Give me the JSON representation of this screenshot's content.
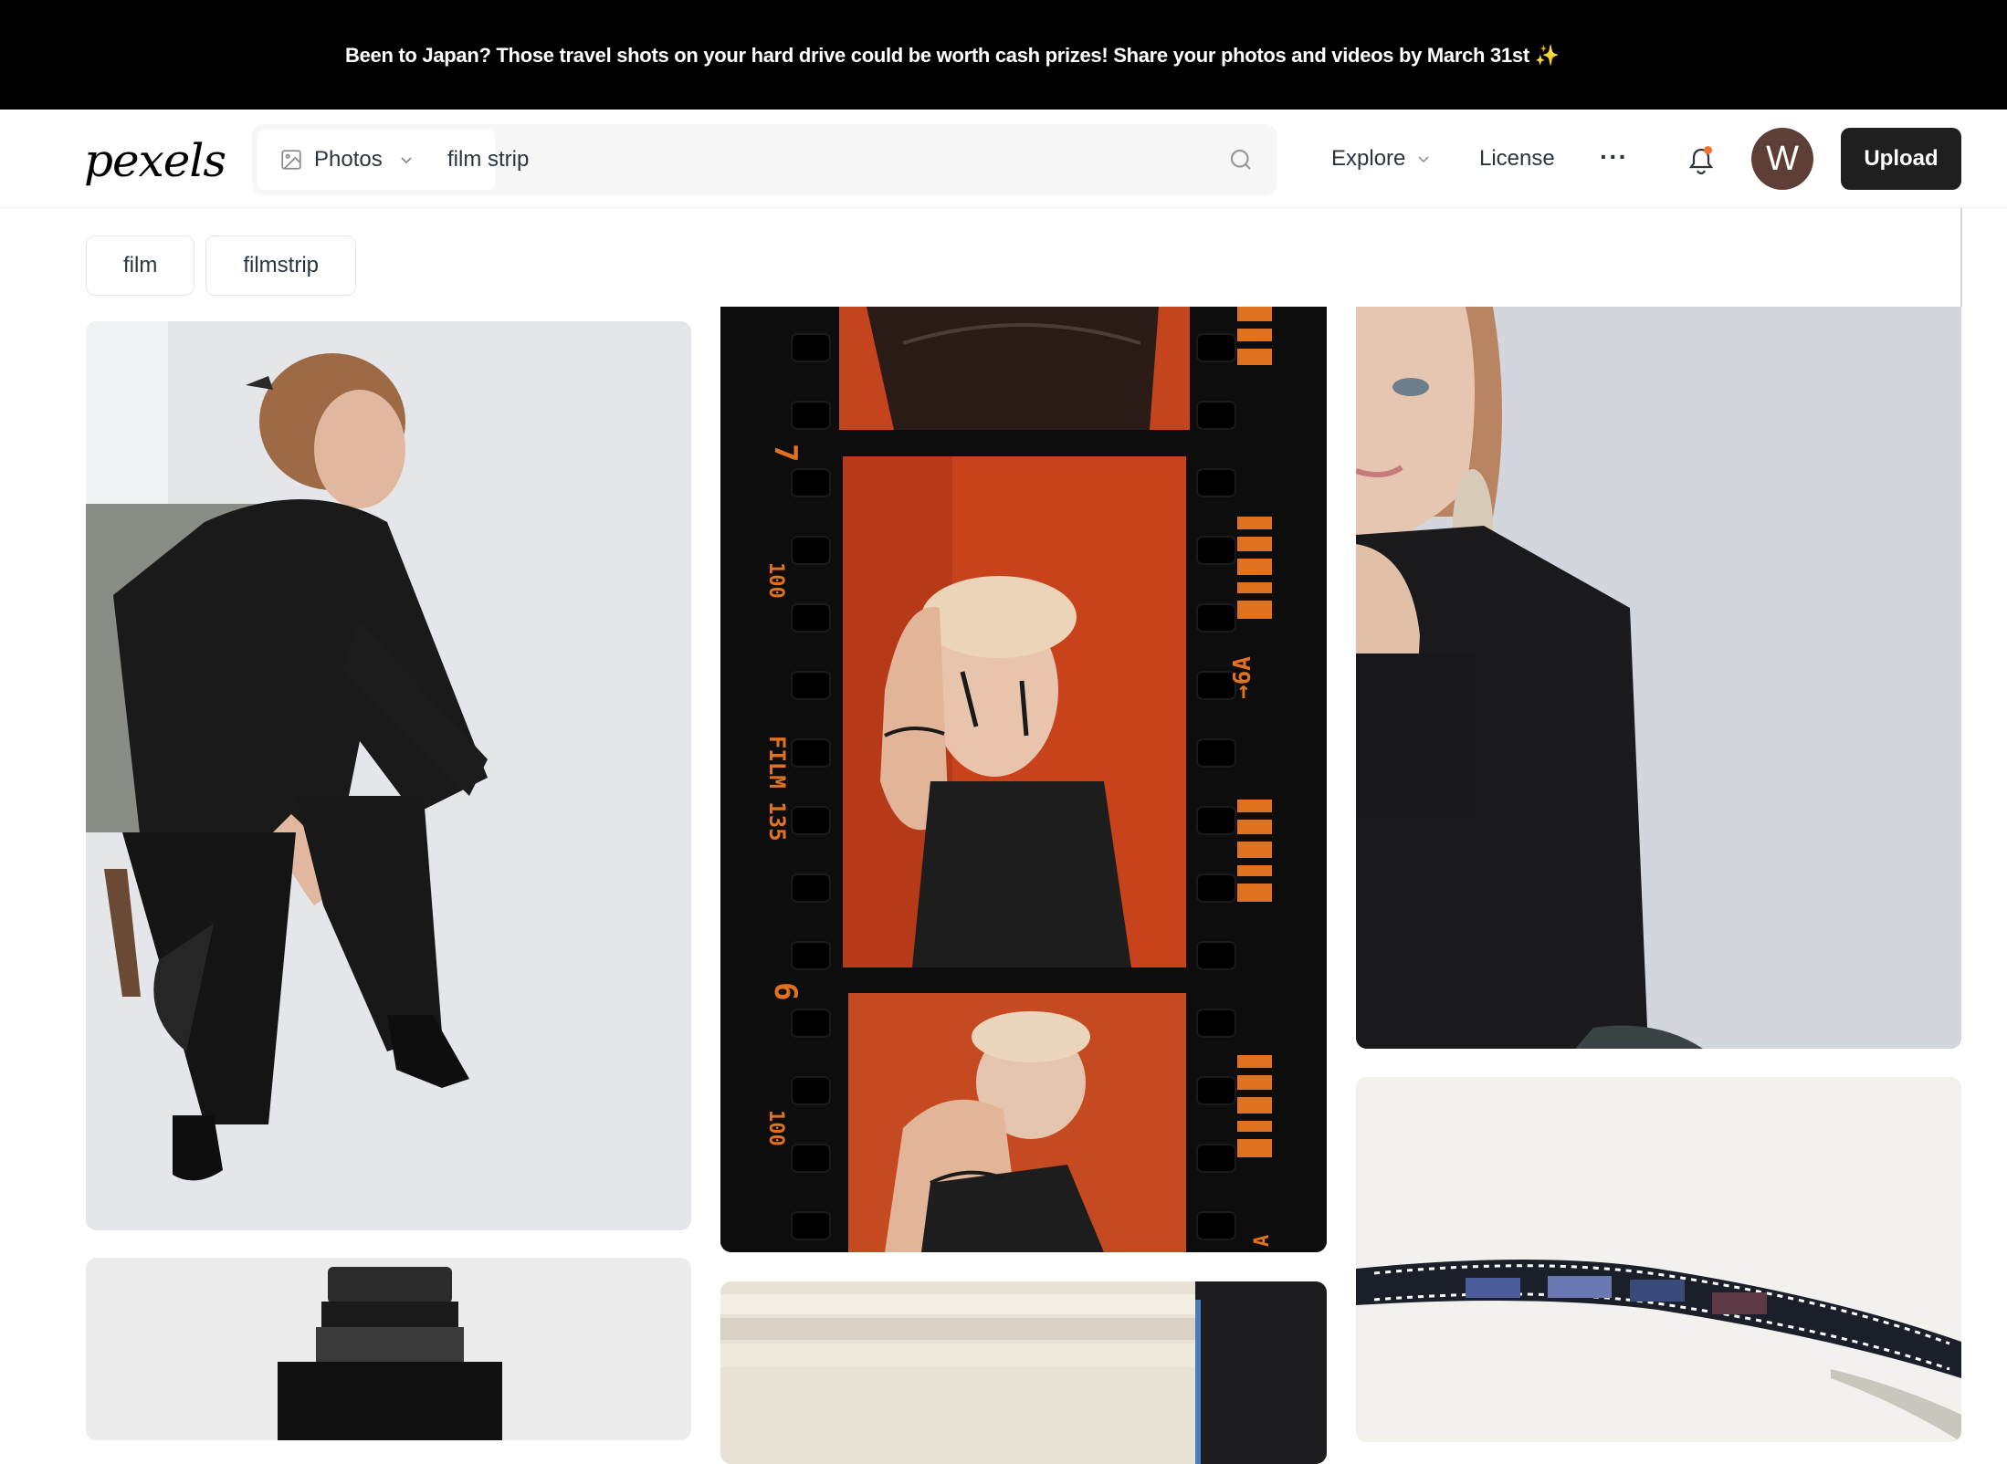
{
  "banner": {
    "text": "Been to Japan? Those travel shots on your hard drive could be worth cash prizes! Share your photos and videos by March 31st ✨"
  },
  "header": {
    "logo": "pexels",
    "search": {
      "type_label": "Photos",
      "query": "film strip"
    },
    "nav": {
      "explore": "Explore",
      "license": "License",
      "more": "···"
    },
    "avatar_initial": "W",
    "upload_label": "Upload"
  },
  "related_searches": [
    "film",
    "filmstrip"
  ],
  "photos": [
    {
      "subject": "woman in black seated on chair"
    },
    {
      "subject": "orange film strip portraits",
      "film_text": {
        "frame_7": "7",
        "frame_100": "100",
        "film135": "FILM 135",
        "frame_6": "6",
        "frame_6a": "→6A",
        "frame_100b": "100",
        "frame_a": "A"
      }
    },
    {
      "subject": "woman in black close portrait"
    },
    {
      "subject": "camera lens"
    },
    {
      "subject": "paper rolls"
    },
    {
      "subject": "curled film strip"
    }
  ],
  "colors": {
    "banner_bg": "#000000",
    "upload_bg": "#1f1f1f",
    "avatar_bg": "#5e3f38",
    "film_orange": "#e0711f",
    "notification_dot": "#f2712d"
  }
}
